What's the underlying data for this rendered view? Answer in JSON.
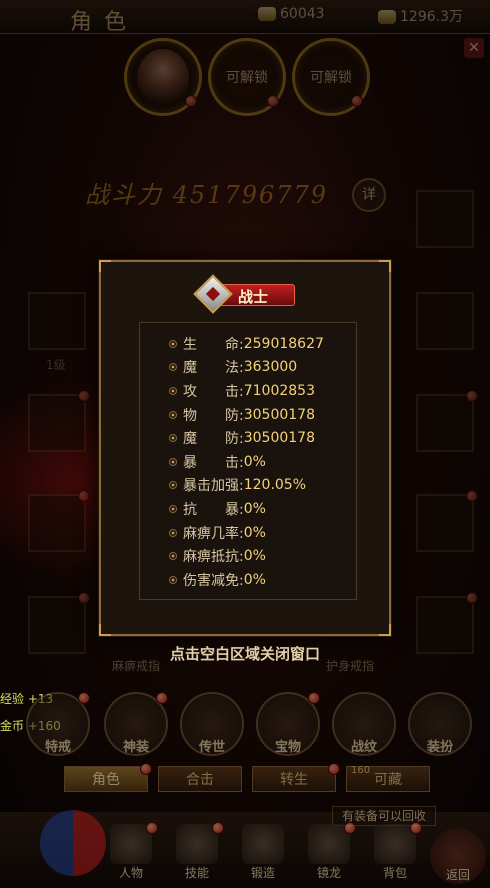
{
  "header": {
    "title": "角色",
    "currency1": "60043",
    "currency2": "1296.3万"
  },
  "slots": {
    "slot2_label": "可解锁",
    "slot3_label": "可解锁"
  },
  "power": {
    "label": "战斗力",
    "value": "451796779",
    "detail_label": "详"
  },
  "equipment": {
    "weapon_level": "1级",
    "left_ring": "麻痹戒指",
    "right_ring": "护身戒指"
  },
  "modal": {
    "class_name": "战士",
    "stats": [
      {
        "key": "生　　命:",
        "value": "259018627"
      },
      {
        "key": "魔　　法:",
        "value": "363000"
      },
      {
        "key": "攻　　击:",
        "value": "71002853"
      },
      {
        "key": "物　　防:",
        "value": "30500178"
      },
      {
        "key": "魔　　防:",
        "value": "30500178"
      },
      {
        "key": "暴　　击:",
        "value": "0%"
      },
      {
        "key": "暴击加强:",
        "value": "120.05%"
      },
      {
        "key": "抗　　暴:",
        "value": "0%"
      },
      {
        "key": "麻痹几率:",
        "value": "0%"
      },
      {
        "key": "麻痹抵抗:",
        "value": "0%"
      },
      {
        "key": "伤害减免:",
        "value": "0%"
      }
    ],
    "close_hint": "点击空白区域关闭窗口"
  },
  "gains": {
    "exp": "经验 +13",
    "gold": "金币  +160"
  },
  "categories": [
    "特戒",
    "神装",
    "传世",
    "宝物",
    "战纹",
    "装扮"
  ],
  "tabs": [
    "角色",
    "合击",
    "转生",
    "可藏"
  ],
  "tab_badge": "160",
  "recycle_hint": "有装备可以回收",
  "nav": [
    "人物",
    "技能",
    "锻造",
    "镜龙",
    "背包"
  ],
  "back_label": "返回"
}
